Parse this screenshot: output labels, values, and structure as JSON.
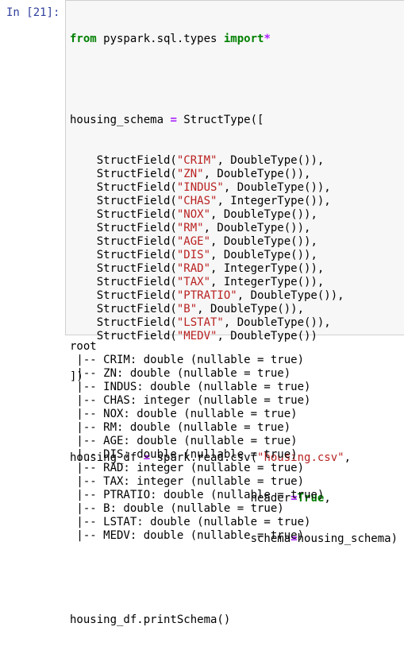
{
  "prompt": "In [21]:",
  "code": {
    "line1": {
      "kw_from": "from",
      "module": " pyspark.sql.types ",
      "kw_import": "import",
      "star": "*"
    },
    "schema_assign": {
      "name": "housing_schema ",
      "eq": "=",
      "rest": " StructType(["
    },
    "fields": [
      {
        "name": "\"CRIM\"",
        "type": ", DoubleType()),"
      },
      {
        "name": "\"ZN\"",
        "type": ", DoubleType()),"
      },
      {
        "name": "\"INDUS\"",
        "type": ", DoubleType()),"
      },
      {
        "name": "\"CHAS\"",
        "type": ", IntegerType()),"
      },
      {
        "name": "\"NOX\"",
        "type": ", DoubleType()),"
      },
      {
        "name": "\"RM\"",
        "type": ", DoubleType()),"
      },
      {
        "name": "\"AGE\"",
        "type": ", DoubleType()),"
      },
      {
        "name": "\"DIS\"",
        "type": ", DoubleType()),"
      },
      {
        "name": "\"RAD\"",
        "type": ", IntegerType()),"
      },
      {
        "name": "\"TAX\"",
        "type": ", IntegerType()),"
      },
      {
        "name": "\"PTRATIO\"",
        "type": ", DoubleType()),"
      },
      {
        "name": "\"B\"",
        "type": ", DoubleType()),"
      },
      {
        "name": "\"LSTAT\"",
        "type": ", DoubleType()),"
      },
      {
        "name": "\"MEDV\"",
        "type": ", DoubleType())"
      }
    ],
    "field_prefix": "    StructField(",
    "close": "])",
    "df_line1": {
      "name": "housing_df ",
      "eq": "=",
      "mid": " spark.read.csv(",
      "path": "\"housing.csv\"",
      "end": ","
    },
    "df_line2": {
      "indent": "                           header",
      "eq": "=",
      "val": "True",
      "end": ","
    },
    "df_line3": {
      "indent": "                           schema",
      "eq": "=",
      "val": "housing_schema)"
    },
    "print_line": "housing_df.printSchema()"
  },
  "output": [
    "root",
    " |-- CRIM: double (nullable = true)",
    " |-- ZN: double (nullable = true)",
    " |-- INDUS: double (nullable = true)",
    " |-- CHAS: integer (nullable = true)",
    " |-- NOX: double (nullable = true)",
    " |-- RM: double (nullable = true)",
    " |-- AGE: double (nullable = true)",
    " |-- DIS: double (nullable = true)",
    " |-- RAD: integer (nullable = true)",
    " |-- TAX: integer (nullable = true)",
    " |-- PTRATIO: double (nullable = true)",
    " |-- B: double (nullable = true)",
    " |-- LSTAT: double (nullable = true)",
    " |-- MEDV: double (nullable = true)"
  ]
}
